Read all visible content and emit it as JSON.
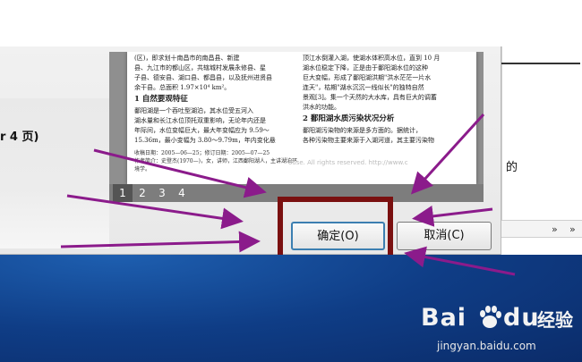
{
  "left_panel": {
    "text": "r 4 页)"
  },
  "right_panel": {
    "text": "的"
  },
  "toolbar": {
    "chevron_a": "»",
    "chevron_b": "»"
  },
  "preview": {
    "left_column": {
      "line1": "(区)，即求划十南昌市的南昌县、新建",
      "line2": "县、九江市的都山区，共辖城村发展永修县、星",
      "line3": "子县、德安县、湖口县、都昌县，以及抚州进贤县",
      "line4": "余干县。总面积 1.97×10⁴ km²。",
      "heading": "1  自然要观特征",
      "para1": "鄱阳湖是一个吞吐型湖泊，其水位受五河入",
      "para2": "湖水量和长江水位顶托双重影响，无论年内还是",
      "para3": "年际间，水位变幅巨大，最大年变幅应为 9.59～",
      "para4": "15.36m，最小变幅为 3.80～9.79m，年内变化悬",
      "meta1": "收稿日期：2005—06—25；修订日期：2005—07—25",
      "meta2": "作者简介：史登杰(1970—)，女，讲师，江西鄱阳湖人，主讲湖泊环境学。"
    },
    "right_column": {
      "line1": "顶江水倒灌入湖，使湖水体积高水位，直到 10 月",
      "line2": "湖水位稳定下降，正是由于鄱阳湖水位的这种",
      "line3": "巨大变幅，形成了鄱阳湖洪期\"洪水茫茫一片水",
      "line4": "连天\"，枯期\"湖水沉沉一线似长\"的独特自然",
      "line5": "景观[3]。集一个天然的大水库，具有巨大的调蓄",
      "line6": "洪水的功能。",
      "heading": "2  鄱阳湖水质污染状况分析",
      "para1": "鄱阳湖污染物的来源是多方面的。据统计，",
      "para2": "各种污染物主要来源于入湖河道，其主要污染物"
    },
    "watermark": "ouse. All rights reserved.   http://www.c",
    "pages": [
      "1",
      "2",
      "3",
      "4"
    ]
  },
  "buttons": {
    "ok": "确定(O)",
    "cancel": "取消(C)"
  },
  "logo": {
    "brand_a": "Bai",
    "brand_b": "du",
    "sub": "经验",
    "url": "jingyan.baidu.com"
  },
  "colors": {
    "arrow": "#8b1b8b",
    "highlight": "#7a1010",
    "taskbar": "#0f3d86"
  }
}
